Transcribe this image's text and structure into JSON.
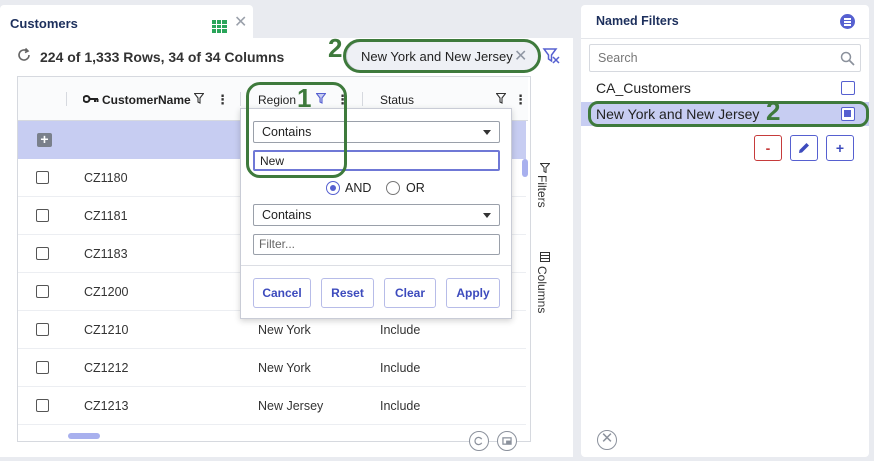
{
  "tab": {
    "title": "Customers",
    "close": "✕"
  },
  "toolbar": {
    "row_count": "224 of 1,333 Rows, 34 of 34 Columns"
  },
  "active_filter": {
    "label": "New York and New Jersey",
    "close": "✕"
  },
  "annotations": {
    "one": "1",
    "two": "2"
  },
  "grid": {
    "headers": {
      "customer": "CustomerName",
      "region": "Region",
      "status": "Status",
      "menu": "⋮"
    },
    "add": "+",
    "rows": [
      {
        "id": "CZ1180",
        "region": "",
        "status": ""
      },
      {
        "id": "CZ1181",
        "region": "",
        "status": ""
      },
      {
        "id": "CZ1183",
        "region": "",
        "status": ""
      },
      {
        "id": "CZ1200",
        "region": "",
        "status": ""
      },
      {
        "id": "CZ1210",
        "region": "New York",
        "status": "Include"
      },
      {
        "id": "CZ1212",
        "region": "New York",
        "status": "Include"
      },
      {
        "id": "CZ1213",
        "region": "New Jersey",
        "status": "Include"
      }
    ]
  },
  "side": {
    "filters": "Filters",
    "columns": "Columns"
  },
  "filter_popup": {
    "condition1": "Contains",
    "value1": "New",
    "and_label": "AND",
    "or_label": "OR",
    "condition2": "Contains",
    "placeholder2": "Filter...",
    "buttons": {
      "cancel": "Cancel",
      "reset": "Reset",
      "clear": "Clear",
      "apply": "Apply"
    }
  },
  "named_filters": {
    "title": "Named Filters",
    "search_placeholder": "Search",
    "items": [
      {
        "label": "CA_Customers",
        "checked": false
      },
      {
        "label": "New York and New Jersey",
        "checked": true
      }
    ],
    "buttons": {
      "remove": "-",
      "add": "+"
    },
    "close": "✕"
  },
  "colors": {
    "accent": "#5660d0",
    "highlight": "#3e7a3c",
    "selected_row": "#c7cdf2",
    "sheet_icon": "#2aa55a"
  }
}
